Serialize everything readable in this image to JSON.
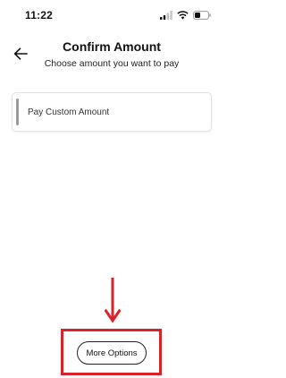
{
  "status_bar": {
    "time": "11:22",
    "icons": [
      "signal-icon",
      "wifi-icon",
      "battery-icon"
    ]
  },
  "header": {
    "title": "Confirm Amount",
    "subtitle": "Choose amount you want to pay",
    "back_icon": "arrow-left-icon"
  },
  "options": [
    {
      "label": "Pay Custom Amount"
    }
  ],
  "footer": {
    "more_options_label": "More Options"
  },
  "annotation": {
    "color": "#d8232a"
  }
}
